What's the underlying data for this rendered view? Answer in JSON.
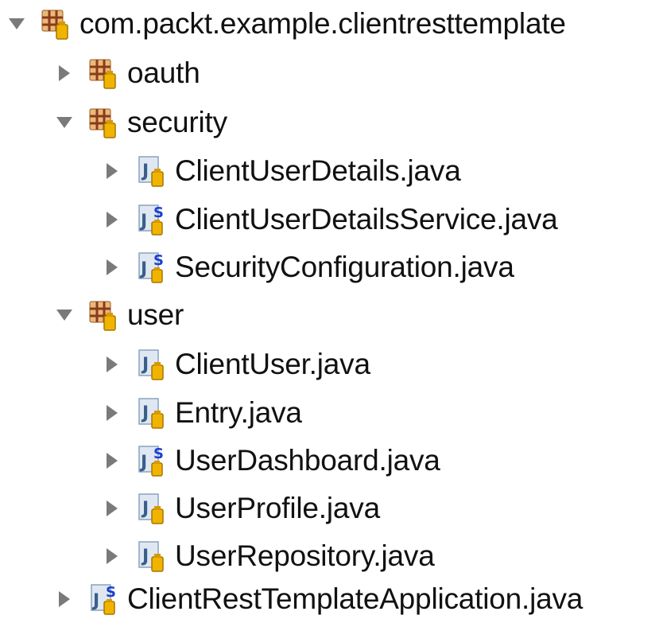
{
  "tree": {
    "root": {
      "label": "com.packt.example.clientresttemplate",
      "expanded": true,
      "icon": "package-icon"
    },
    "packages": [
      {
        "label": "oauth",
        "expanded": false,
        "icon": "package-icon",
        "children": []
      },
      {
        "label": "security",
        "expanded": true,
        "icon": "package-icon",
        "children": [
          {
            "label": "ClientUserDetails.java",
            "icon": "java-file-icon"
          },
          {
            "label": "ClientUserDetailsService.java",
            "icon": "spring-java-file-icon"
          },
          {
            "label": "SecurityConfiguration.java",
            "icon": "spring-java-file-icon"
          }
        ]
      },
      {
        "label": "user",
        "expanded": true,
        "icon": "package-icon",
        "children": [
          {
            "label": "ClientUser.java",
            "icon": "java-file-icon"
          },
          {
            "label": "Entry.java",
            "icon": "java-file-icon"
          },
          {
            "label": "UserDashboard.java",
            "icon": "spring-java-file-icon"
          },
          {
            "label": "UserProfile.java",
            "icon": "java-file-icon"
          },
          {
            "label": "UserRepository.java",
            "icon": "java-file-icon"
          }
        ]
      }
    ],
    "files": [
      {
        "label": "ClientRestTemplateApplication.java",
        "icon": "spring-java-file-icon"
      }
    ]
  }
}
